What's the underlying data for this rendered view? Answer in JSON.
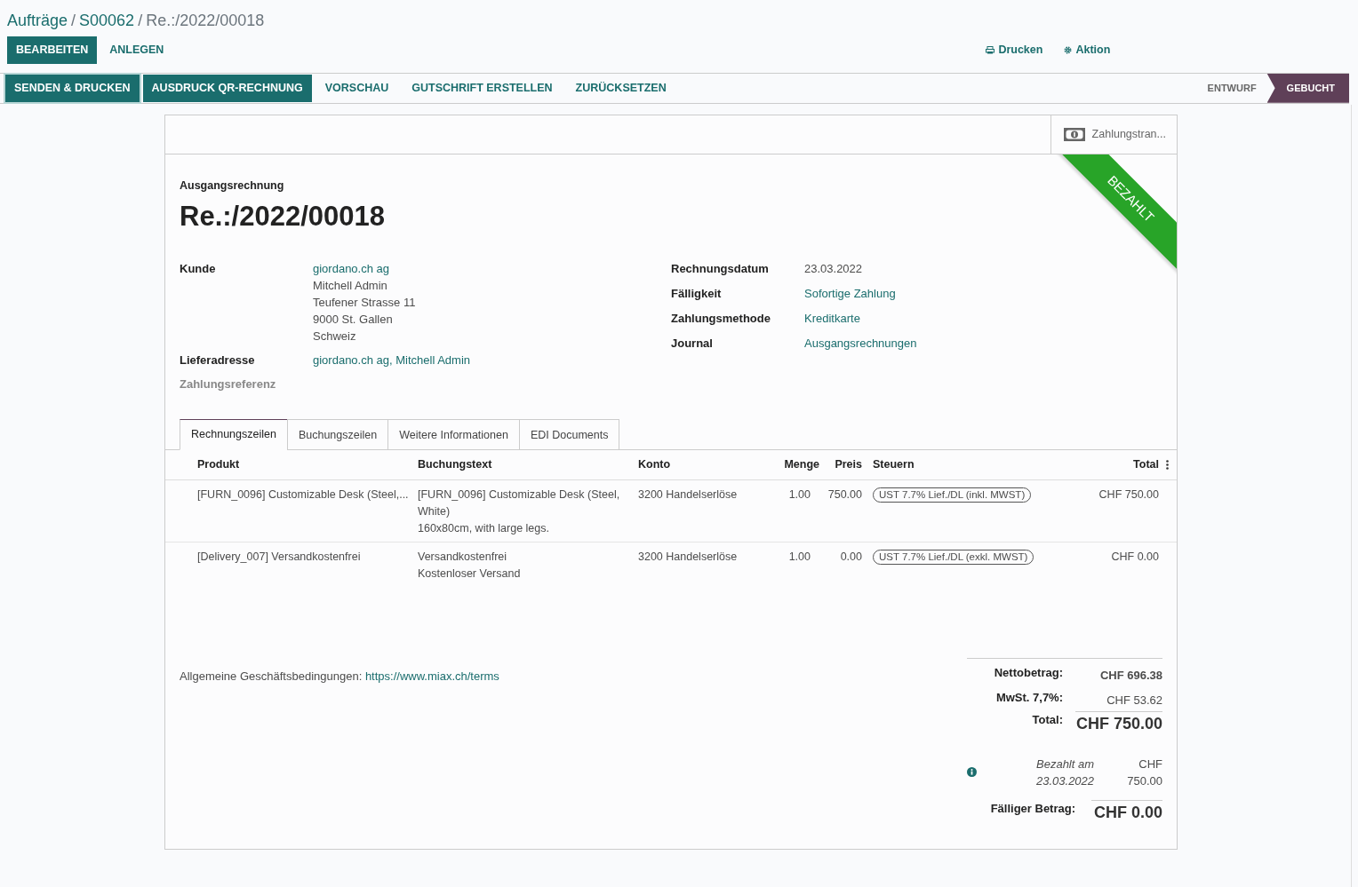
{
  "breadcrumb_separator": "/",
  "breadcrumbs": [
    {
      "label": "Aufträge",
      "kind": "link"
    },
    {
      "label": "S00062",
      "kind": "link"
    },
    {
      "label": "Re.:/2022/00018",
      "kind": "current"
    }
  ],
  "control_buttons": [
    {
      "label": "BEARBEITEN",
      "primary": true
    },
    {
      "label": "ANLEGEN",
      "primary": false
    }
  ],
  "top_actions": [
    {
      "label": "Drucken",
      "kind": "print"
    },
    {
      "label": "Aktion",
      "kind": "gear"
    }
  ],
  "action_buttons": [
    {
      "label": "SENDEN & DRUCKEN",
      "primary": true,
      "focused": true
    },
    {
      "label": "AUSDRUCK QR-RECHNUNG",
      "primary": true,
      "focused": false
    },
    {
      "label": "VORSCHAU",
      "primary": false,
      "focused": false
    },
    {
      "label": "GUTSCHRIFT ERSTELLEN",
      "primary": false,
      "focused": false
    },
    {
      "label": "ZURÜCKSETZEN",
      "primary": false,
      "focused": false
    }
  ],
  "status_stages": [
    {
      "label": "ENTWURF",
      "selected": false
    },
    {
      "label": "GEBUCHT",
      "selected": true
    }
  ],
  "smart_button": {
    "label": "Zahlungstran..."
  },
  "ribbon": {
    "label": "BEZAHLT"
  },
  "document_type": "Ausgangsrechnung",
  "title": "Re.:/2022/00018",
  "fields_left": [
    {
      "label": "Kunde",
      "muted": false,
      "lines": [
        {
          "text": "giordano.ch ag",
          "link": true
        },
        {
          "text": "Mitchell Admin",
          "link": false
        },
        {
          "text": "Teufener Strasse 11",
          "link": false
        },
        {
          "text": "9000 St. Gallen",
          "link": false
        },
        {
          "text": "Schweiz",
          "link": false
        }
      ]
    },
    {
      "label": "Lieferadresse",
      "muted": false,
      "lines": [
        {
          "text": "giordano.ch ag, Mitchell Admin",
          "link": true
        }
      ]
    },
    {
      "label": "Zahlungsreferenz",
      "muted": true
    }
  ],
  "fields_right": [
    {
      "label": "Rechnungsdatum",
      "value": "23.03.2022",
      "link": false
    },
    {
      "label": "Fälligkeit",
      "value": "Sofortige Zahlung",
      "link": true
    },
    {
      "label": "Zahlungsmethode",
      "value": "Kreditkarte",
      "link": true
    },
    {
      "label": "Journal",
      "value": "Ausgangsrechnungen",
      "link": true
    }
  ],
  "tabs": [
    {
      "label": "Rechnungszeilen",
      "selected": true
    },
    {
      "label": "Buchungszeilen",
      "selected": false
    },
    {
      "label": "Weitere Informationen",
      "selected": false
    },
    {
      "label": "EDI Documents",
      "selected": false
    }
  ],
  "table": {
    "columns": [
      "Produkt",
      "Buchungstext",
      "Konto",
      "Menge",
      "Preis",
      "Steuern",
      "Total"
    ],
    "rows": [
      {
        "product": "[FURN_0096] Customizable Desk (Steel,...",
        "description": [
          "[FURN_0096] Customizable Desk (Steel, White)",
          "160x80cm, with large legs."
        ],
        "account": "3200 Handelserlöse",
        "quantity": "1.00",
        "price": "750.00",
        "tax": "UST 7.7% Lief./DL (inkl. MWST)",
        "total": "CHF 750.00"
      },
      {
        "product": "[Delivery_007] Versandkostenfrei",
        "description": [
          "Versandkostenfrei",
          "Kostenloser Versand"
        ],
        "account": "3200 Handelserlöse",
        "quantity": "1.00",
        "price": "0.00",
        "tax": "UST 7.7% Lief./DL (exkl. MWST)",
        "total": "CHF 0.00"
      }
    ]
  },
  "terms": {
    "label": "Allgemeine Geschäftsbedingungen:",
    "link": "https://www.miax.ch/terms"
  },
  "totals": [
    {
      "label": "Nettobetrag:",
      "value": "CHF 696.38",
      "kind": "bold"
    },
    {
      "label": "MwSt. 7,7%:",
      "value": "CHF 53.62",
      "kind": "plain"
    },
    {
      "label": "Total:",
      "value": "CHF 750.00",
      "kind": "grand"
    }
  ],
  "payment": {
    "label": [
      "Bezahlt am",
      "23.03.2022"
    ],
    "amount": [
      "CHF",
      "750.00"
    ]
  },
  "amount_due": {
    "label": "Fälliger Betrag:",
    "value": "CHF 0.00"
  }
}
